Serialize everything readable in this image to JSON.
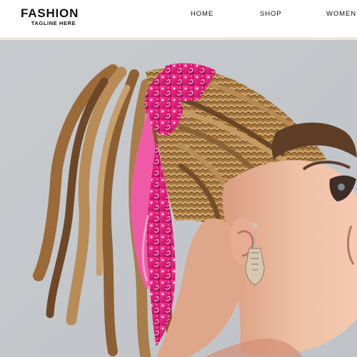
{
  "header": {
    "brand": "FASHION",
    "tagline": "TAGLINE HERE"
  },
  "nav": {
    "items": [
      {
        "id": "home",
        "label": "HOME"
      },
      {
        "id": "shop",
        "label": "SHOP"
      },
      {
        "id": "women",
        "label": "WOMEN"
      }
    ]
  },
  "hero": {
    "image_icon": "model-profile-photo",
    "colors": {
      "background": "#c3c7cb",
      "scarf": "#d81b73",
      "hair": "#b58a56",
      "skin": "#e9b79b"
    }
  }
}
